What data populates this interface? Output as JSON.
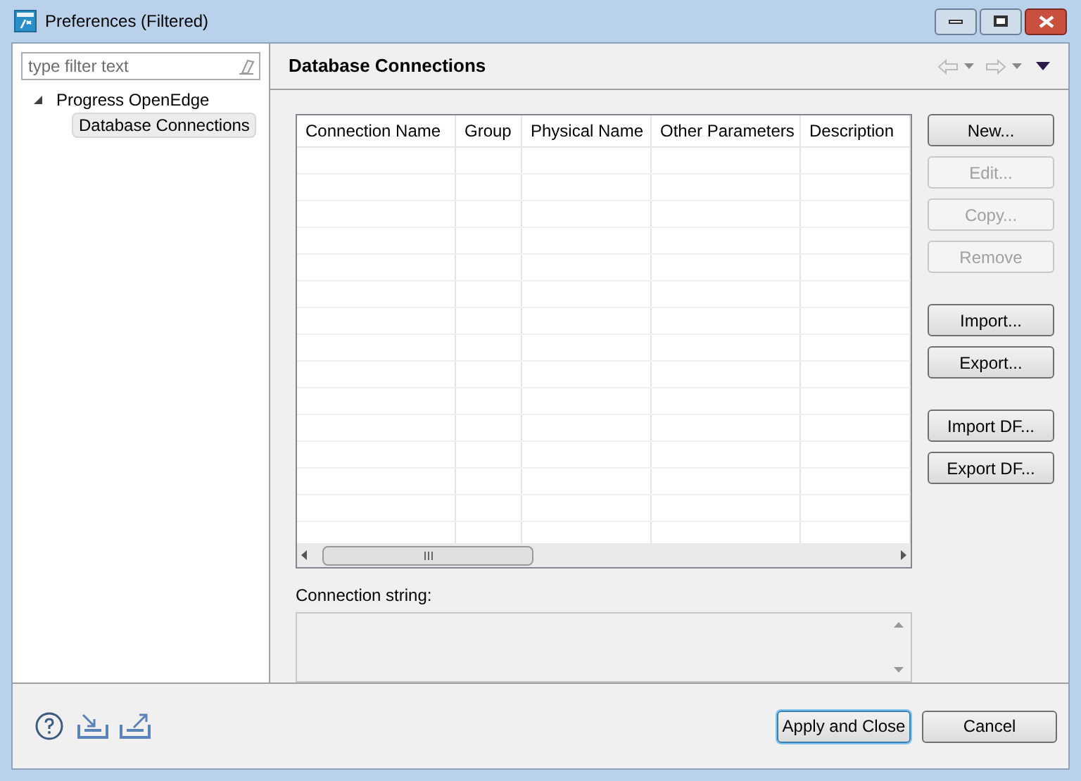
{
  "window": {
    "title": "Preferences (Filtered)"
  },
  "filter": {
    "placeholder": "type filter text"
  },
  "tree": [
    {
      "label": "Progress OpenEdge",
      "expanded": true,
      "selected": false,
      "children": [
        {
          "label": "Database Connections",
          "selected": true
        }
      ]
    }
  ],
  "page": {
    "title": "Database Connections"
  },
  "table": {
    "columns": [
      "Connection Name",
      "Group",
      "Physical Name",
      "Other Parameters",
      "Description"
    ]
  },
  "button_groups": [
    [
      {
        "label": "New...",
        "disabled": false
      },
      {
        "label": "Edit...",
        "disabled": true
      },
      {
        "label": "Copy...",
        "disabled": true
      },
      {
        "label": "Remove",
        "disabled": true
      }
    ],
    [
      {
        "label": "Import...",
        "disabled": false
      },
      {
        "label": "Export...",
        "disabled": false
      }
    ],
    [
      {
        "label": "Import DF...",
        "disabled": false
      },
      {
        "label": "Export DF...",
        "disabled": false
      }
    ]
  ],
  "connection_string": {
    "label": "Connection string:"
  },
  "footer": {
    "buttons": [
      {
        "label": "Apply and Close",
        "default": true
      },
      {
        "label": "Cancel",
        "default": false
      }
    ]
  }
}
